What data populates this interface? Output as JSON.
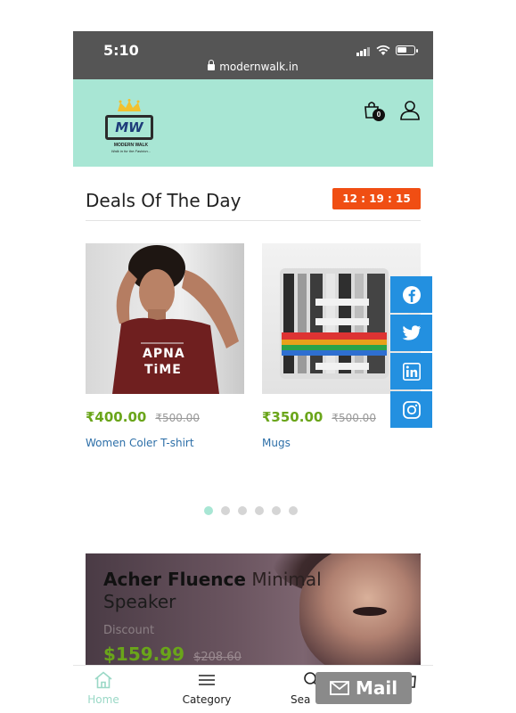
{
  "status_bar": {
    "time": "5:10",
    "url": "modernwalk.in"
  },
  "header": {
    "logo": {
      "monogram": "MW",
      "brand": "MODERN WALK",
      "tagline": "Walk in for the Fashion..."
    },
    "cart_count": "0"
  },
  "deals": {
    "title": "Deals Of The Day",
    "timer": "12 : 19 : 15",
    "products": [
      {
        "name": "Women Coler T-shirt",
        "price": "₹400.00",
        "old_price": "₹500.00",
        "shirt_text_1": "APNA",
        "shirt_text_2": "TiME"
      },
      {
        "name": "Mugs",
        "price": "₹350.00",
        "old_price": "₹500.00"
      }
    ],
    "carousel_dots": 6,
    "active_dot": 0
  },
  "social": [
    "facebook",
    "twitter",
    "linkedin",
    "instagram"
  ],
  "banner": {
    "title_bold": "Acher Fluence",
    "title_rest": "Minimal",
    "title_line2": "Speaker",
    "discount_label": "Discount",
    "price": "$159.99",
    "old_price": "$208.60"
  },
  "bottom_nav": {
    "home": "Home",
    "category": "Category",
    "search": "Sea",
    "cart": "rt"
  },
  "mail_button": "Mail",
  "colors": {
    "accent": "#a8e6d4",
    "timer": "#f04e13",
    "price": "#6aa51a",
    "link": "#2d6fa8",
    "social": "#2390e0"
  }
}
